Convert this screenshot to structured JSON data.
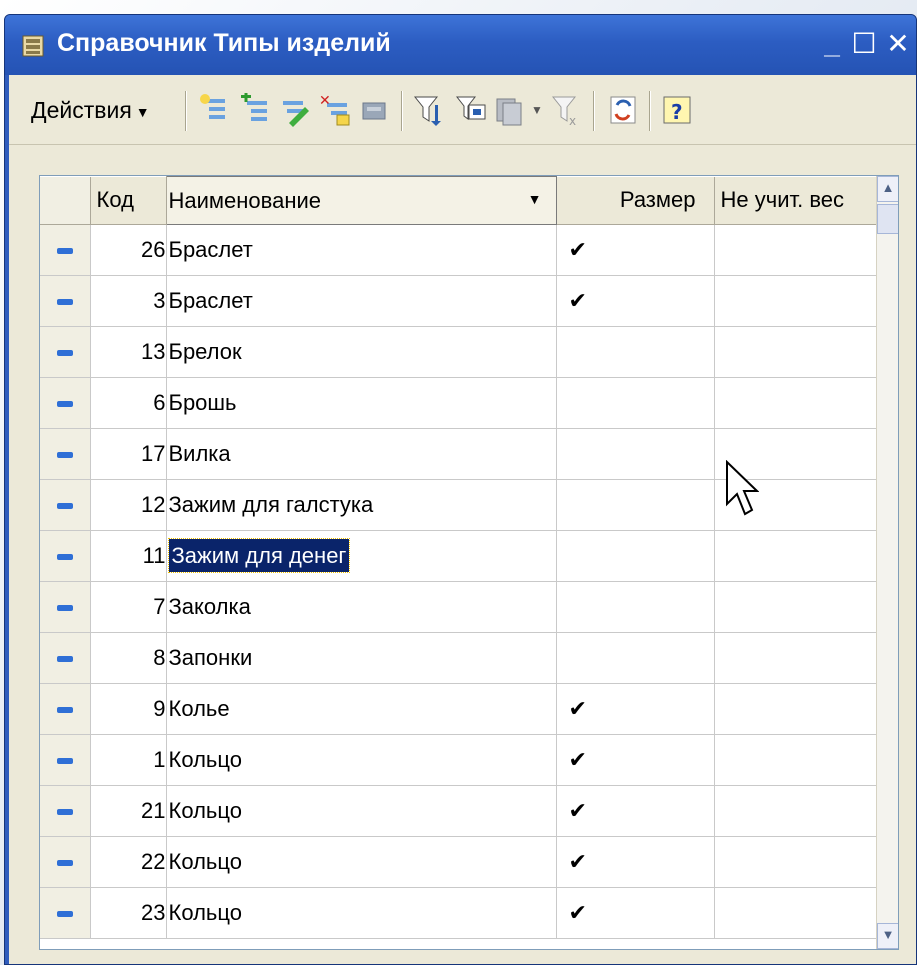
{
  "window": {
    "title": "Справочник Типы изделий",
    "controls": {
      "minimize": "_",
      "maximize": "☐",
      "close": "✕"
    }
  },
  "toolbar": {
    "actions_label": "Действия",
    "icons": [
      "add-item-icon",
      "add-group-icon",
      "edit-item-icon",
      "delete-mark-icon",
      "move-to-group-icon",
      "filter-icon",
      "filter-value-icon",
      "history-icon",
      "clear-filter-icon",
      "refresh-icon",
      "help-icon"
    ]
  },
  "table": {
    "columns": [
      "Код",
      "Наименование",
      "Размер",
      "Не учит. вес"
    ],
    "sorted_column": "Наименование",
    "selected_row_index": 6,
    "rows": [
      {
        "code": "26",
        "name": "Браслет",
        "size": "✔",
        "no_weight": ""
      },
      {
        "code": "3",
        "name": "Браслет",
        "size": "✔",
        "no_weight": ""
      },
      {
        "code": "13",
        "name": "Брелок",
        "size": "",
        "no_weight": ""
      },
      {
        "code": "6",
        "name": "Брошь",
        "size": "",
        "no_weight": ""
      },
      {
        "code": "17",
        "name": "Вилка",
        "size": "",
        "no_weight": ""
      },
      {
        "code": "12",
        "name": "Зажим для галстука",
        "size": "",
        "no_weight": ""
      },
      {
        "code": "11",
        "name": "Зажим для денег",
        "size": "",
        "no_weight": ""
      },
      {
        "code": "7",
        "name": "Заколка",
        "size": "",
        "no_weight": ""
      },
      {
        "code": "8",
        "name": "Запонки",
        "size": "",
        "no_weight": ""
      },
      {
        "code": "9",
        "name": "Колье",
        "size": "✔",
        "no_weight": ""
      },
      {
        "code": "1",
        "name": "Кольцо",
        "size": "✔",
        "no_weight": ""
      },
      {
        "code": "21",
        "name": "Кольцо",
        "size": "✔",
        "no_weight": ""
      },
      {
        "code": "22",
        "name": "Кольцо",
        "size": "✔",
        "no_weight": ""
      },
      {
        "code": "23",
        "name": "Кольцо",
        "size": "✔",
        "no_weight": ""
      }
    ]
  },
  "colors": {
    "titlebar": "#2c5dc2",
    "selection": "#0a246a",
    "row_marker": "#2f6fd6"
  }
}
